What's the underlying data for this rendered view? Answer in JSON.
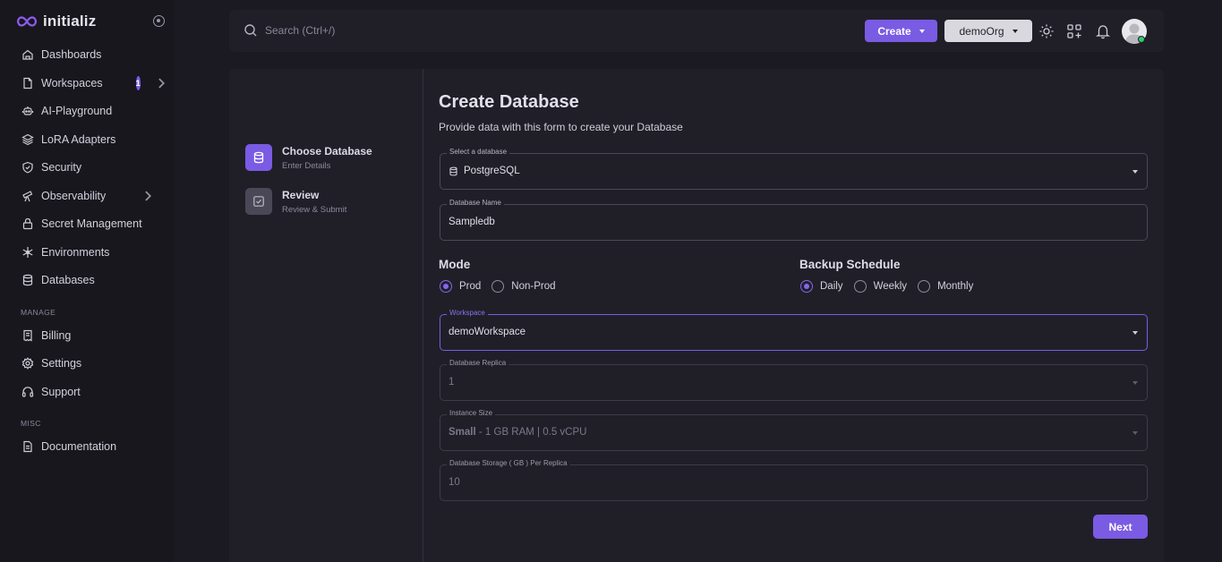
{
  "app": {
    "name": "initializ",
    "brand_color": "#7a5be3"
  },
  "sidebar": {
    "items": [
      {
        "label": "Dashboards",
        "icon": "home-icon"
      },
      {
        "label": "Workspaces",
        "icon": "file-icon",
        "badge": "1"
      },
      {
        "label": "AI-Playground",
        "icon": "robot-icon"
      },
      {
        "label": "LoRA Adapters",
        "icon": "layers-icon"
      },
      {
        "label": "Security",
        "icon": "shield-icon"
      },
      {
        "label": "Observability",
        "icon": "telescope-icon"
      },
      {
        "label": "Secret Management",
        "icon": "lock-icon"
      },
      {
        "label": "Environments",
        "icon": "snowflake-icon"
      },
      {
        "label": "Databases",
        "icon": "database-icon"
      }
    ],
    "manage_label": "MANAGE",
    "manage_items": [
      {
        "label": "Billing",
        "icon": "receipt-icon"
      },
      {
        "label": "Settings",
        "icon": "gear-icon"
      },
      {
        "label": "Support",
        "icon": "headset-icon"
      }
    ],
    "misc_label": "MISC",
    "misc_items": [
      {
        "label": "Documentation",
        "icon": "document-icon"
      }
    ]
  },
  "topbar": {
    "search_placeholder": "Search (Ctrl+/)",
    "create_label": "Create",
    "org_label": "demoOrg"
  },
  "steps": [
    {
      "title": "Choose Database",
      "subtitle": "Enter Details",
      "icon": "database-icon",
      "active": true
    },
    {
      "title": "Review",
      "subtitle": "Review & Submit",
      "icon": "checkbox-icon",
      "active": false
    }
  ],
  "form": {
    "title": "Create Database",
    "subtitle": "Provide data with this form to create your Database",
    "select_database": {
      "label": "Select a database",
      "value": "PostgreSQL"
    },
    "database_name": {
      "label": "Database Name",
      "value": "Sampledb"
    },
    "mode": {
      "title": "Mode",
      "options": [
        "Prod",
        "Non-Prod"
      ],
      "selected": "Prod"
    },
    "backup": {
      "title": "Backup Schedule",
      "options": [
        "Daily",
        "Weekly",
        "Monthly"
      ],
      "selected": "Daily"
    },
    "workspace": {
      "label": "Workspace",
      "value": "demoWorkspace"
    },
    "replica": {
      "label": "Database Replica",
      "value": "1"
    },
    "instance_size": {
      "label": "Instance Size",
      "value_bold": "Small",
      "value_rest": " - 1 GB RAM | 0.5 vCPU"
    },
    "storage": {
      "label": "Database Storage ( GB ) Per Replica",
      "value": "10"
    },
    "next_label": "Next"
  }
}
